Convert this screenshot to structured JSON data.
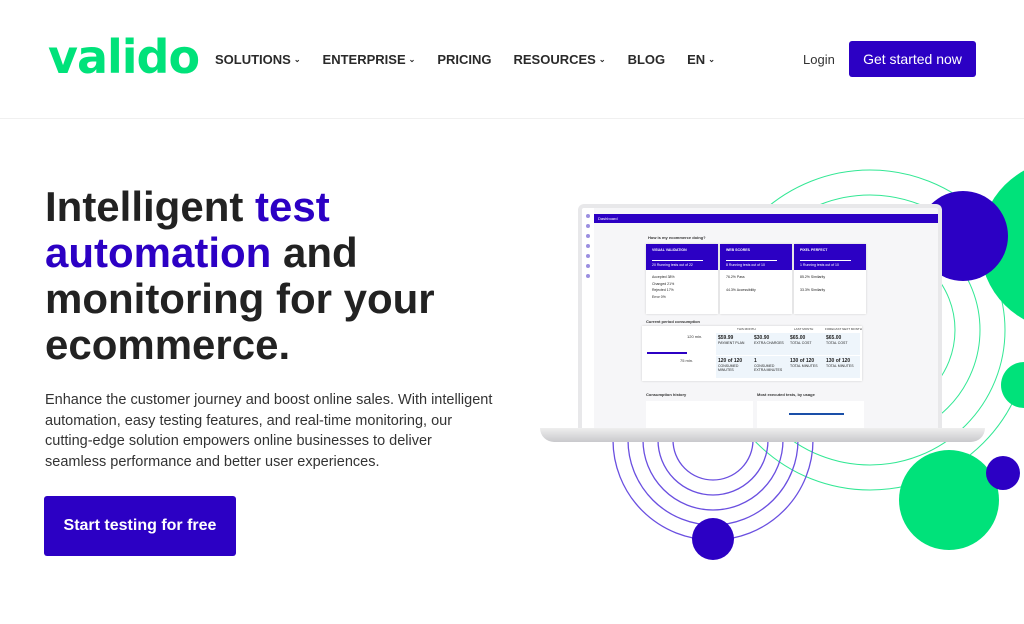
{
  "header": {
    "logo": "valido",
    "nav": [
      {
        "label": "SOLUTIONS",
        "dropdown": true
      },
      {
        "label": "ENTERPRISE",
        "dropdown": true
      },
      {
        "label": "PRICING",
        "dropdown": false
      },
      {
        "label": "RESOURCES",
        "dropdown": true
      },
      {
        "label": "BLOG",
        "dropdown": false
      },
      {
        "label": "EN",
        "dropdown": true
      }
    ],
    "login": "Login",
    "cta": "Get started now"
  },
  "hero": {
    "title_1": "Intelligent ",
    "title_accent": "test automation",
    "title_2": " and monitoring for your ecommerce.",
    "description": "Enhance the customer journey and boost online sales. With intelligent automation, easy testing features, and real-time monitoring, our cutting-edge solution empowers online businesses to deliver seamless performance and better user experiences.",
    "button": "Start testing for free"
  },
  "dashboard": {
    "title": "Dashboard",
    "question": "How is my ecommerce doing?",
    "cards": [
      {
        "title": "VISUAL VALIDATION",
        "sub": "20 Running tests out of 22",
        "rows": [
          "Accepted 38%",
          "Changed 21%",
          "Rejected 17%",
          "Error 0%"
        ]
      },
      {
        "title": "WEB SCORES",
        "sub": "8 Running tests out of 10",
        "rows": [
          "76.2% Pass",
          "44.3% Accessibility"
        ]
      },
      {
        "title": "PIXEL PERFECT",
        "sub": "1 Running tests out of 10",
        "rows": [
          "85.2% Similarity",
          "33.3% Similarity"
        ]
      }
    ],
    "consumption_title": "Current period consumption",
    "cols": [
      "THIS MONTH",
      "LAST MONTH",
      "FORECAST NEXT MONTH"
    ],
    "cells": [
      [
        "$59.99",
        "PAYMENT PLAN"
      ],
      [
        "$30.90",
        "EXTRA CHARGES"
      ],
      [
        "$65.00",
        "TOTAL COST"
      ],
      [
        "$65.00",
        "TOTAL COST"
      ],
      [
        "120 of 120",
        "CONSUMED MINUTES"
      ],
      [
        "1",
        "CONSUMED EXTRA MINUTES"
      ],
      [
        "130 of 120",
        "TOTAL MINUTES"
      ],
      [
        "130 of 120",
        "TOTAL MINUTES"
      ]
    ],
    "minutes_plan": "120 min.",
    "minutes_used": "75 min.",
    "history_title": "Consumption history",
    "most_title": "Most executed tests, by usage"
  },
  "colors": {
    "brand_green": "#00e27a",
    "brand_purple": "#2c00c4"
  }
}
